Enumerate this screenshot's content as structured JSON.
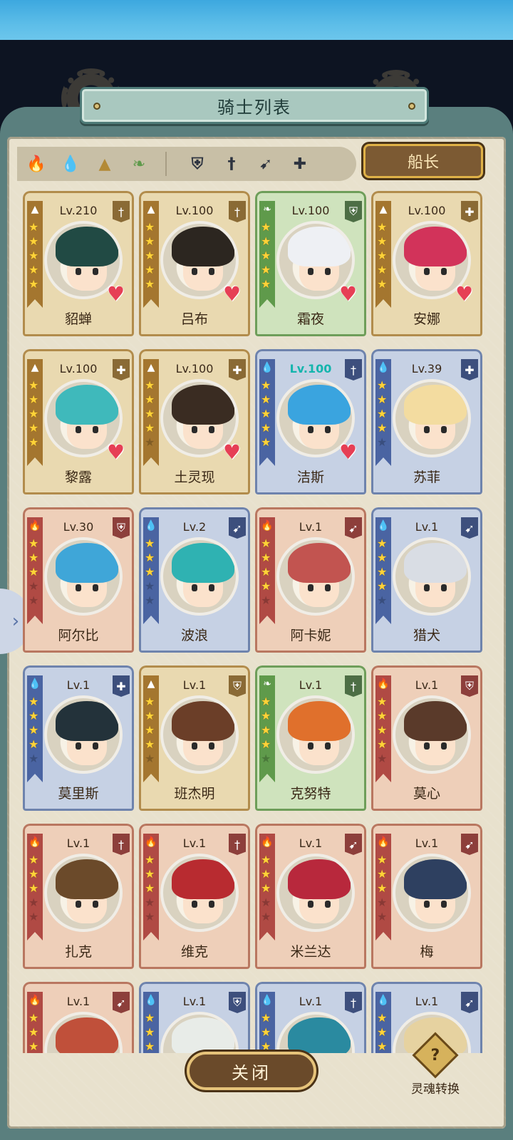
{
  "title": "骑士列表",
  "captain_label": "船长",
  "close_label": "关闭",
  "soul_label": "灵魂转换",
  "soul_icon_text": "?",
  "side_tab_icon": "chevron-right-icon",
  "filters": {
    "elements": [
      {
        "name": "fire-element-icon",
        "glyph": "🔥",
        "color": "#b23a3a"
      },
      {
        "name": "water-element-icon",
        "glyph": "💧",
        "color": "#2f74c8"
      },
      {
        "name": "earth-element-icon",
        "glyph": "▲",
        "color": "#b38a35"
      },
      {
        "name": "wind-element-icon",
        "glyph": "❧",
        "color": "#5f9a4b"
      }
    ],
    "classes": [
      {
        "name": "shield-class-icon",
        "glyph": "⛨"
      },
      {
        "name": "sword-class-icon",
        "glyph": "†"
      },
      {
        "name": "bow-class-icon",
        "glyph": "➹"
      },
      {
        "name": "healer-class-icon",
        "glyph": "✚"
      }
    ]
  },
  "knights": [
    {
      "name": "貂蝉",
      "level": "Lv.210",
      "element": "earth",
      "cls": "sword",
      "stars": 5,
      "heart": true,
      "max": false,
      "hair": "#214a44"
    },
    {
      "name": "吕布",
      "level": "Lv.100",
      "element": "earth",
      "cls": "sword",
      "stars": 5,
      "heart": true,
      "max": false,
      "hair": "#2c2620"
    },
    {
      "name": "霜夜",
      "level": "Lv.100",
      "element": "wind",
      "cls": "shield",
      "stars": 5,
      "heart": true,
      "max": false,
      "hair": "#eef0f4"
    },
    {
      "name": "安娜",
      "level": "Lv.100",
      "element": "earth",
      "cls": "healer",
      "stars": 5,
      "heart": true,
      "max": false,
      "hair": "#d2335a"
    },
    {
      "name": "黎露",
      "level": "Lv.100",
      "element": "earth",
      "cls": "healer",
      "stars": 5,
      "heart": true,
      "max": false,
      "hair": "#3fb9bb"
    },
    {
      "name": "土灵现",
      "level": "Lv.100",
      "element": "earth",
      "cls": "healer",
      "stars": 4,
      "heart": true,
      "max": false,
      "hair": "#3a2c22"
    },
    {
      "name": "洁斯",
      "level": "Lv.100",
      "element": "water",
      "cls": "sword",
      "stars": 5,
      "heart": true,
      "max": true,
      "hair": "#3aa4df"
    },
    {
      "name": "苏菲",
      "level": "Lv.39",
      "element": "water",
      "cls": "healer",
      "stars": 4,
      "heart": false,
      "max": false,
      "hair": "#f3dca0"
    },
    {
      "name": "阿尔比",
      "level": "Lv.30",
      "element": "fire",
      "cls": "shield",
      "stars": 3,
      "heart": false,
      "max": false,
      "hair": "#3fa6d8"
    },
    {
      "name": "波浪",
      "level": "Lv.2",
      "element": "water",
      "cls": "bow",
      "stars": 3,
      "heart": false,
      "max": false,
      "hair": "#2fb2b2"
    },
    {
      "name": "阿卡妮",
      "level": "Lv.1",
      "element": "fire",
      "cls": "bow",
      "stars": 4,
      "heart": false,
      "max": false,
      "hair": "#c25450"
    },
    {
      "name": "猎犬",
      "level": "Lv.1",
      "element": "water",
      "cls": "bow",
      "stars": 4,
      "heart": false,
      "max": false,
      "hair": "#d9dde4"
    },
    {
      "name": "莫里斯",
      "level": "Lv.1",
      "element": "water",
      "cls": "healer",
      "stars": 4,
      "heart": false,
      "max": false,
      "hair": "#23323a"
    },
    {
      "name": "班杰明",
      "level": "Lv.1",
      "element": "earth",
      "cls": "shield",
      "stars": 4,
      "heart": false,
      "max": false,
      "hair": "#6b3e28"
    },
    {
      "name": "克努特",
      "level": "Lv.1",
      "element": "wind",
      "cls": "sword",
      "stars": 4,
      "heart": false,
      "max": false,
      "hair": "#e0702c"
    },
    {
      "name": "莫心",
      "level": "Lv.1",
      "element": "fire",
      "cls": "shield",
      "stars": 4,
      "heart": false,
      "max": false,
      "hair": "#5a3a2a"
    },
    {
      "name": "扎克",
      "level": "Lv.1",
      "element": "fire",
      "cls": "sword",
      "stars": 3,
      "heart": false,
      "max": false,
      "hair": "#6b4a2a"
    },
    {
      "name": "维克",
      "level": "Lv.1",
      "element": "fire",
      "cls": "sword",
      "stars": 3,
      "heart": false,
      "max": false,
      "hair": "#b82b30"
    },
    {
      "name": "米兰达",
      "level": "Lv.1",
      "element": "fire",
      "cls": "bow",
      "stars": 3,
      "heart": false,
      "max": false,
      "hair": "#b8283c"
    },
    {
      "name": "梅",
      "level": "Lv.1",
      "element": "fire",
      "cls": "bow",
      "stars": 3,
      "heart": false,
      "max": false,
      "hair": "#2e4060"
    },
    {
      "name": "",
      "level": "Lv.1",
      "element": "fire",
      "cls": "bow",
      "stars": 3,
      "heart": false,
      "max": false,
      "hair": "#c0503a"
    },
    {
      "name": "",
      "level": "Lv.1",
      "element": "water",
      "cls": "shield",
      "stars": 3,
      "heart": false,
      "max": false,
      "hair": "#e8ece8"
    },
    {
      "name": "",
      "level": "Lv.1",
      "element": "water",
      "cls": "sword",
      "stars": 3,
      "heart": false,
      "max": false,
      "hair": "#2a8aa0"
    },
    {
      "name": "",
      "level": "Lv.1",
      "element": "water",
      "cls": "bow",
      "stars": 3,
      "heart": false,
      "max": false,
      "hair": "#e6d2a0"
    }
  ]
}
